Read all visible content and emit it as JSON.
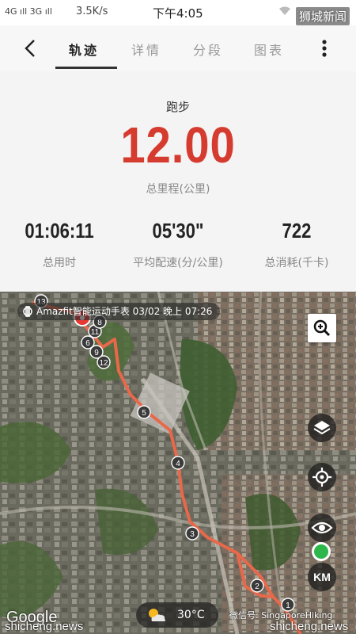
{
  "status_bar": {
    "signal": "4G ıll 3G ıll",
    "net_speed": "3.5K/s",
    "time": "下午4:05",
    "watermark": "狮城新闻"
  },
  "tabs": [
    {
      "label": "轨迹",
      "active": true
    },
    {
      "label": "详情",
      "active": false
    },
    {
      "label": "分段",
      "active": false
    },
    {
      "label": "图表",
      "active": false
    }
  ],
  "summary": {
    "activity": "跑步",
    "distance": "12.00",
    "distance_label": "总里程(公里)",
    "stats": [
      {
        "value": "01:06:11",
        "label": "总用时"
      },
      {
        "value": "05'30\"",
        "label": "平均配速(分/公里)"
      },
      {
        "value": "722",
        "label": "总消耗(千卡)"
      }
    ]
  },
  "map": {
    "device_chip": "Amazfit智能运动手表  03/02 晚上 07:26",
    "km_label": "KM",
    "google_label": "Google",
    "weather_temp": "30°C",
    "wechat_label": "微信号: SingaporeHiking",
    "watermark_left": "shicheng.news",
    "watermark_right": "shicheng.news",
    "km_markers": [
      "1",
      "2",
      "3",
      "4",
      "5",
      "12",
      "9",
      "6",
      "11",
      "8",
      "13"
    ],
    "route_color": "#e8684a"
  },
  "colors": {
    "accent": "#d63b2f",
    "start_dot": "#2db64a"
  }
}
